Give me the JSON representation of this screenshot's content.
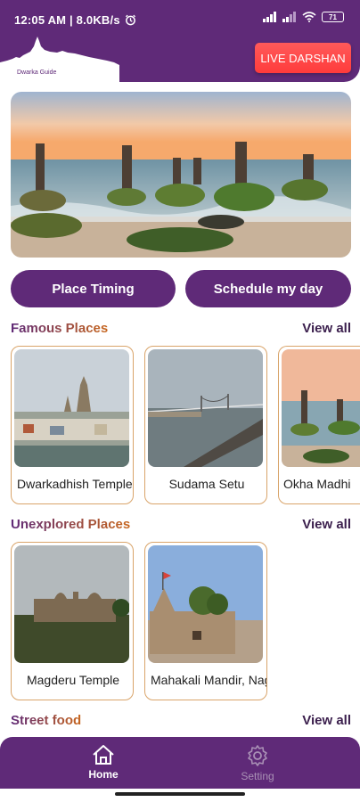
{
  "status_bar": {
    "time_speed": "12:05 AM | 8.0KB/s",
    "battery": "71"
  },
  "header": {
    "logo_text": "Dwarka Guide",
    "live_button": "LIVE DARSHAN"
  },
  "actions": {
    "place_timing": "Place Timing",
    "schedule": "Schedule my day"
  },
  "famous": {
    "title": "Famous Places",
    "view_all": "View all",
    "items": [
      {
        "label": "Dwarkadhish Temple"
      },
      {
        "label": "Sudama Setu"
      },
      {
        "label": "Okha Madhi"
      }
    ]
  },
  "unexplored": {
    "title": "Unexplored Places",
    "view_all": "View all",
    "items": [
      {
        "label": "Magderu Temple"
      },
      {
        "label": "Mahakali Mandir, Nageshwar"
      }
    ]
  },
  "street_food": {
    "title": "Street food",
    "view_all": "View all"
  },
  "nav": {
    "home": "Home",
    "setting": "Setting"
  },
  "colors": {
    "primary": "#5f2a78",
    "accent_red": "#ff4545",
    "card_border": "#d9a46a"
  }
}
